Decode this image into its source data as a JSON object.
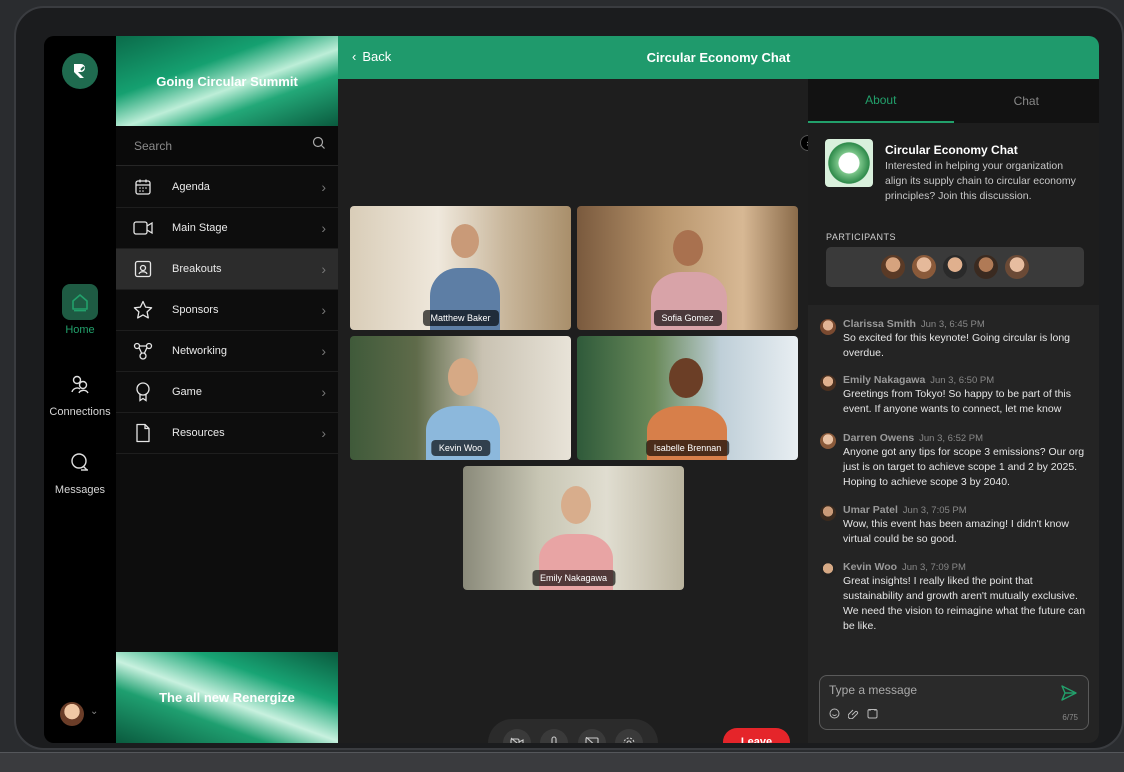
{
  "rail": {
    "items": [
      {
        "label": "Home",
        "icon": "home-icon"
      },
      {
        "label": "Connections",
        "icon": "connections-icon"
      },
      {
        "label": "Messages",
        "icon": "messages-icon"
      }
    ]
  },
  "sidebar": {
    "event_title": "Going Circular Summit",
    "search_placeholder": "Search",
    "menu": [
      {
        "label": "Agenda",
        "icon": "calendar-icon"
      },
      {
        "label": "Main Stage",
        "icon": "video-icon"
      },
      {
        "label": "Breakouts",
        "icon": "breakouts-icon"
      },
      {
        "label": "Sponsors",
        "icon": "star-icon"
      },
      {
        "label": "Networking",
        "icon": "networking-icon"
      },
      {
        "label": "Game",
        "icon": "trophy-icon"
      },
      {
        "label": "Resources",
        "icon": "document-icon"
      }
    ],
    "promo": "The all new Renergize"
  },
  "header": {
    "back_label": "Back",
    "title": "Circular Economy Chat"
  },
  "stage": {
    "participants": [
      "Matthew Baker",
      "Sofia Gomez",
      "Kevin Woo",
      "Isabelle Brennan",
      "Emily Nakagawa"
    ],
    "leave_label": "Leave"
  },
  "panel": {
    "tabs": [
      "About",
      "Chat"
    ],
    "room_title": "Circular Economy Chat",
    "room_desc": "Interested in helping your organization align its supply chain to circular economy principles? Join this discussion.",
    "participants_label": "PARTICIPANTS",
    "messages": [
      {
        "name": "Clarissa Smith",
        "time": "Jun 3, 6:45 PM",
        "text": "So excited for this keynote! Going circular is long overdue."
      },
      {
        "name": "Emily Nakagawa",
        "time": "Jun 3, 6:50 PM",
        "text": "Greetings from Tokyo! So happy to be part of this event. If anyone wants to connect, let me know"
      },
      {
        "name": "Darren Owens",
        "time": "Jun 3, 6:52 PM",
        "text": "Anyone got any tips for scope 3 emissions? Our org just is on target to achieve scope 1 and 2 by 2025. Hoping to achieve scope 3 by 2040."
      },
      {
        "name": "Umar Patel",
        "time": "Jun 3, 7:05 PM",
        "text": "Wow, this event has been amazing! I didn't know virtual could be so good."
      },
      {
        "name": "Kevin Woo",
        "time": "Jun 3, 7:09 PM",
        "text": "Great insights! I really liked the point that sustainability and growth aren't mutually exclusive. We need the vision to reimagine what the future can be like."
      }
    ],
    "composer_placeholder": "Type a message",
    "char_count": "6/75"
  },
  "colors": {
    "accent": "#1f9a6c",
    "leave": "#e5252a"
  }
}
